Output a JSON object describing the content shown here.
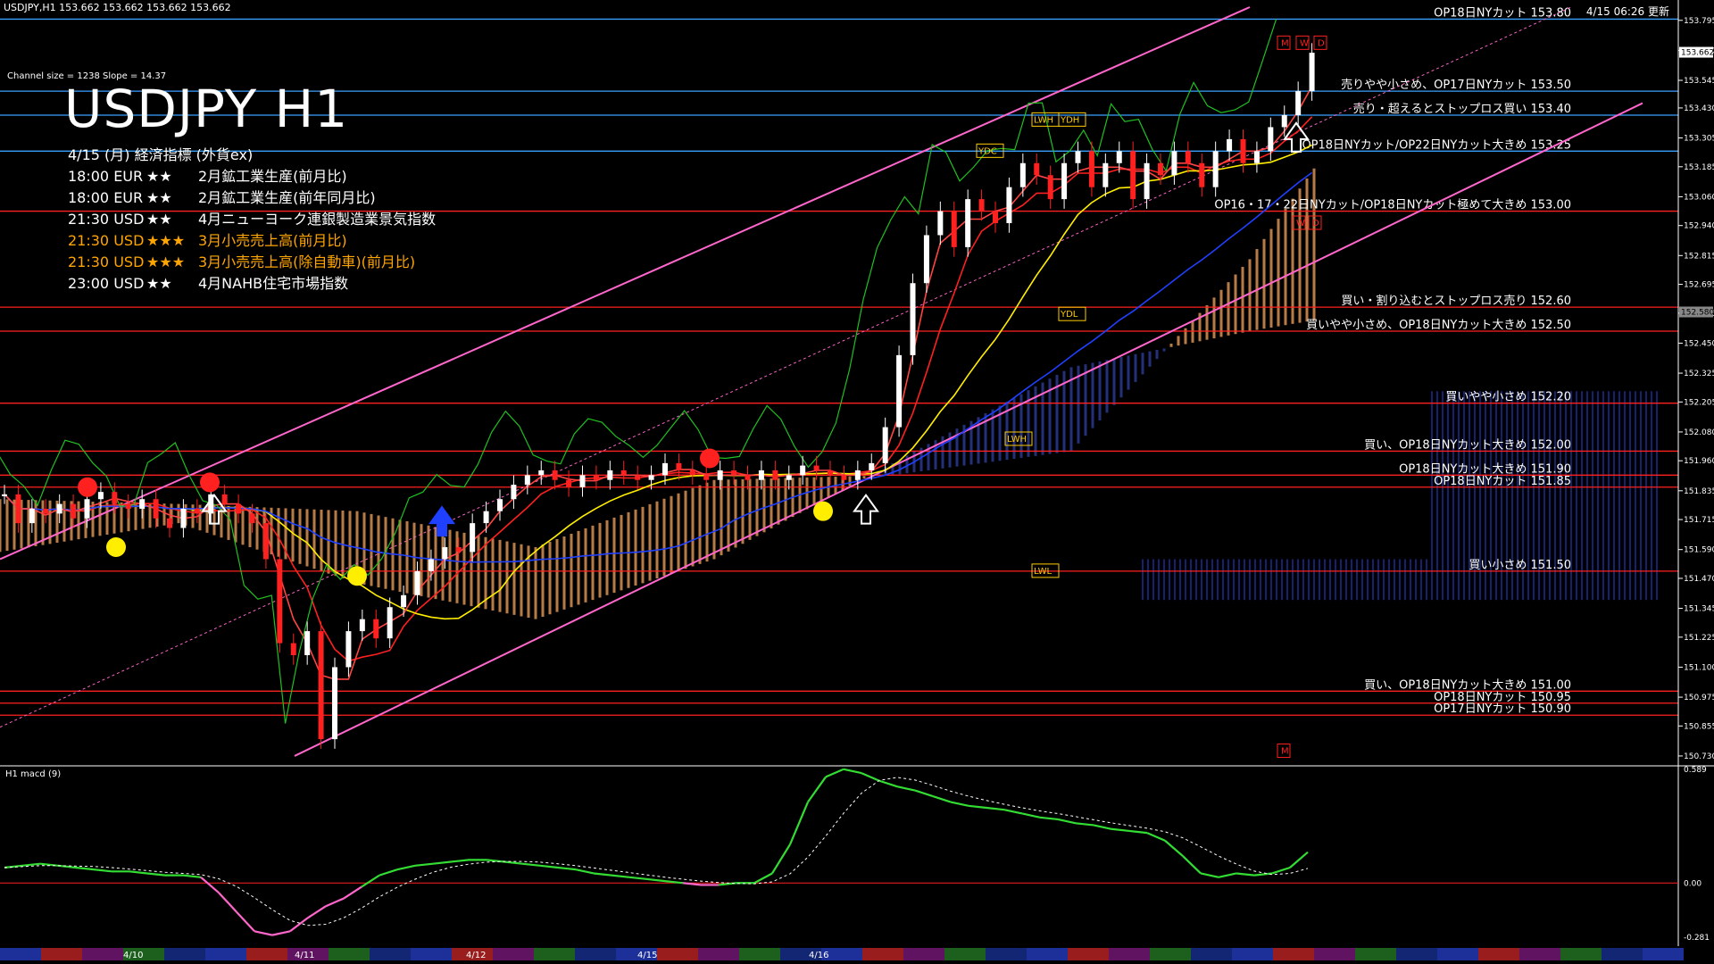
{
  "header": {
    "symbol_info": "USDJPY,H1  153.662 153.662 153.662 153.662",
    "channel_info": "Channel size = 1238 Slope = 14.37",
    "title": "USDJPY H1",
    "timestamp": "4/15 06:26 更新"
  },
  "calendar": {
    "heading": "4/15 (月) 経済指標 (外貨ex)",
    "events": [
      {
        "time": "18:00 EUR",
        "stars": "★★",
        "name": "2月鉱工業生産(前月比)",
        "color": "#ffffff"
      },
      {
        "time": "18:00 EUR",
        "stars": "★★",
        "name": "2月鉱工業生産(前年同月比)",
        "color": "#ffffff"
      },
      {
        "time": "21:30 USD",
        "stars": "★★",
        "name": "4月ニューヨーク連銀製造業景気指数",
        "color": "#ffffff"
      },
      {
        "time": "21:30 USD",
        "stars": "★★★",
        "name": "3月小売売上高(前月比)",
        "color": "#ffa500"
      },
      {
        "time": "21:30 USD",
        "stars": "★★★",
        "name": "3月小売売上高(除自動車)(前月比)",
        "color": "#ffa500"
      },
      {
        "time": "23:00 USD",
        "stars": "★★",
        "name": "4月NAHB住宅市場指数",
        "color": "#ffffff"
      }
    ]
  },
  "macd": {
    "label": "H1  macd (9)"
  },
  "chart_data": {
    "type": "line",
    "ylim": [
      150.7,
      153.85
    ],
    "yticks": [
      "153.795",
      "153.670",
      "153.545",
      "153.430",
      "153.305",
      "153.185",
      "153.060",
      "152.940",
      "152.815",
      "152.695",
      "152.575",
      "152.450",
      "152.325",
      "152.205",
      "152.080",
      "151.960",
      "151.835",
      "151.715",
      "151.590",
      "151.470",
      "151.345",
      "151.225",
      "151.100",
      "150.975",
      "150.855",
      "150.730"
    ],
    "current_price": {
      "label": "153.662",
      "value": 153.662
    },
    "marked_price": {
      "label": "152.580",
      "value": 152.58
    },
    "xlabels": [
      "4/10",
      "4/11",
      "4/12",
      "4/15",
      "4/16"
    ],
    "levels": [
      {
        "price": 153.8,
        "label": "OP18日NYカット 153.80",
        "color": "#3aa0ff"
      },
      {
        "price": 153.5,
        "label": "売りやや小さめ、OP17日NYカット 153.50",
        "color": "#3aa0ff"
      },
      {
        "price": 153.4,
        "label": "売り・超えるとストップロス買い 153.40",
        "color": "#3aa0ff"
      },
      {
        "price": 153.25,
        "label": "OP18日NYカット/OP22日NYカット大きめ 153.25",
        "color": "#3aa0ff"
      },
      {
        "price": 153.0,
        "label": "OP16・17・22日NYカット/OP18日NYカット極めて大きめ 153.00",
        "color": "#ff2020"
      },
      {
        "price": 152.6,
        "label": "買い・割り込むとストップロス売り 152.60",
        "color": "#ff2020"
      },
      {
        "price": 152.5,
        "label": "買いやや小さめ、OP18日NYカット大きめ 152.50",
        "color": "#ff2020"
      },
      {
        "price": 152.2,
        "label": "買いやや小さめ 152.20",
        "color": "#ff2020"
      },
      {
        "price": 152.0,
        "label": "買い、OP18日NYカット大きめ 152.00",
        "color": "#ff2020"
      },
      {
        "price": 151.9,
        "label": "OP18日NYカット大きめ 151.90",
        "color": "#ff2020"
      },
      {
        "price": 151.85,
        "label": "OP18日NYカット 151.85",
        "color": "#ff2020"
      },
      {
        "price": 151.5,
        "label": "買い小さめ 151.50",
        "color": "#ff2020"
      },
      {
        "price": 151.0,
        "label": "買い、OP18日NYカット大きめ 151.00",
        "color": "#ff2020"
      },
      {
        "price": 150.95,
        "label": "OP18日NYカット 150.95",
        "color": "#ff2020"
      },
      {
        "price": 150.9,
        "label": "OP17日NYカット 150.90",
        "color": "#ff2020"
      }
    ],
    "price_path": [
      151.82,
      151.7,
      151.76,
      151.74,
      151.78,
      151.72,
      151.8,
      151.83,
      151.78,
      151.76,
      151.8,
      151.72,
      151.68,
      151.76,
      151.74,
      151.82,
      151.78,
      151.74,
      151.7,
      151.55,
      151.2,
      151.15,
      151.25,
      150.8,
      151.1,
      151.25,
      151.3,
      151.22,
      151.35,
      151.4,
      151.5,
      151.55,
      151.6,
      151.58,
      151.7,
      151.75,
      151.8,
      151.86,
      151.9,
      151.92,
      151.88,
      151.85,
      151.9,
      151.88,
      151.92,
      151.9,
      151.88,
      151.9,
      151.95,
      151.92,
      151.9,
      151.88,
      151.92,
      151.9,
      151.88,
      151.92,
      151.88,
      151.9,
      151.94,
      151.92,
      151.9,
      151.88,
      151.92,
      151.95,
      152.1,
      152.4,
      152.7,
      152.9,
      153.0,
      152.85,
      153.05,
      153.0,
      152.95,
      153.1,
      153.2,
      153.15,
      153.05,
      153.2,
      153.25,
      153.1,
      153.2,
      153.25,
      153.05,
      153.2,
      153.15,
      153.25,
      153.2,
      153.1,
      153.25,
      153.3,
      153.2,
      153.25,
      153.35,
      153.4,
      153.5,
      153.66
    ],
    "markers": [
      {
        "text": "LWH"
      },
      {
        "text": "YDH"
      },
      {
        "text": "YDC"
      },
      {
        "text": "YDL"
      },
      {
        "text": "LWL"
      },
      {
        "text": "LWH"
      },
      {
        "text": "M"
      },
      {
        "text": "W"
      },
      {
        "text": "D"
      },
      {
        "text": "W"
      },
      {
        "text": "D"
      },
      {
        "text": "M"
      }
    ],
    "macd_ylim": [
      -0.281,
      0.589
    ],
    "macd_ticks": [
      "0.589",
      "0.00",
      "-0.281"
    ],
    "macd_values": [
      0.08,
      0.09,
      0.1,
      0.09,
      0.08,
      0.07,
      0.06,
      0.06,
      0.05,
      0.04,
      0.04,
      0.03,
      -0.05,
      -0.15,
      -0.25,
      -0.27,
      -0.25,
      -0.18,
      -0.12,
      -0.08,
      -0.02,
      0.04,
      0.07,
      0.09,
      0.1,
      0.11,
      0.12,
      0.12,
      0.11,
      0.1,
      0.09,
      0.08,
      0.07,
      0.05,
      0.04,
      0.03,
      0.02,
      0.01,
      0.0,
      -0.01,
      -0.01,
      0.0,
      0.0,
      0.05,
      0.2,
      0.42,
      0.55,
      0.59,
      0.57,
      0.53,
      0.5,
      0.48,
      0.45,
      0.42,
      0.4,
      0.39,
      0.38,
      0.36,
      0.34,
      0.33,
      0.31,
      0.3,
      0.28,
      0.27,
      0.26,
      0.22,
      0.14,
      0.05,
      0.03,
      0.05,
      0.04,
      0.05,
      0.08,
      0.16
    ]
  }
}
